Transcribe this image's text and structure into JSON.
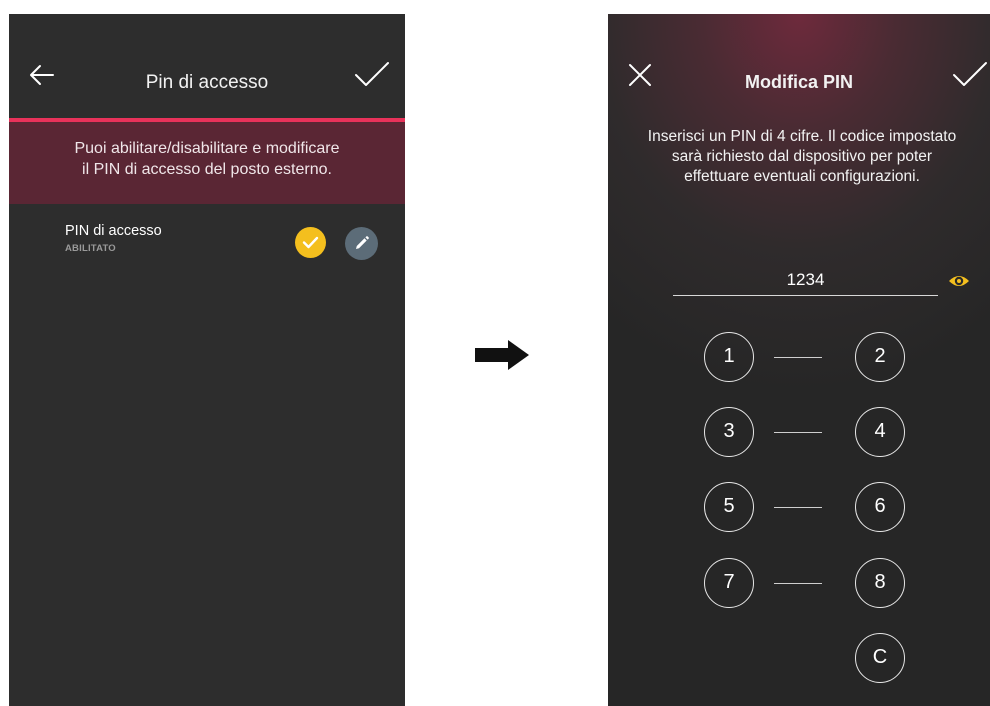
{
  "left_screen": {
    "header": {
      "title": "Pin di accesso",
      "back_icon": "arrow-left-icon",
      "confirm_icon": "check-icon"
    },
    "banner": {
      "line1": "Puoi abilitare/disabilitare e modificare",
      "line2": "il PIN di accesso del posto esterno.",
      "accent_color": "#e8325a"
    },
    "pin_row": {
      "title": "PIN di accesso",
      "status": "ABILITATO",
      "toggle_color": "#f4bf1e",
      "edit_icon": "pencil-icon"
    }
  },
  "arrow": {
    "icon": "arrow-right-icon"
  },
  "right_screen": {
    "header": {
      "title": "Modifica PIN",
      "close_icon": "close-icon",
      "confirm_icon": "check-icon"
    },
    "description": {
      "line1": "Inserisci un PIN di 4 cifre. Il codice impostato",
      "line2": "sarà richiesto dal dispositivo per poter",
      "line3": "effettuare eventuali configurazioni."
    },
    "pin_value": "1234",
    "eye_icon_color": "#f4bf1e",
    "keypad": [
      "1",
      "2",
      "3",
      "4",
      "5",
      "6",
      "7",
      "8",
      "C"
    ]
  }
}
